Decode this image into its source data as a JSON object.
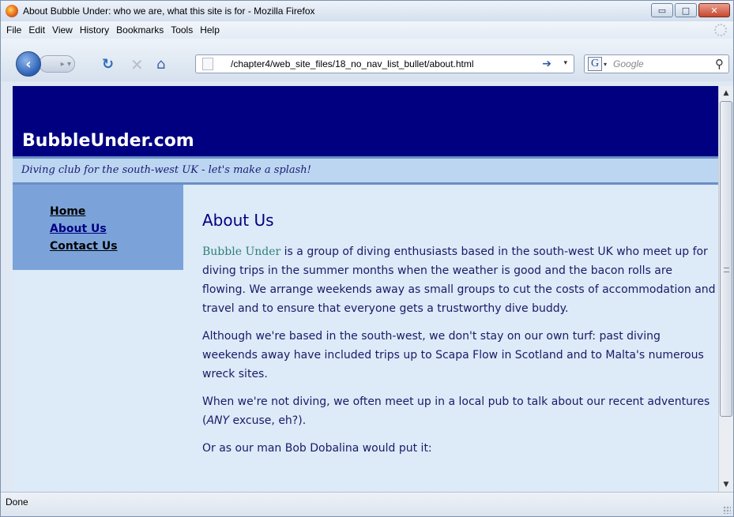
{
  "window": {
    "title": "About Bubble Under: who we are, what this site is for - Mozilla Firefox",
    "minimize_glyph": "▭",
    "maximize_glyph": "□",
    "close_glyph": "✕"
  },
  "menu": {
    "items": [
      "File",
      "Edit",
      "View",
      "History",
      "Bookmarks",
      "Tools",
      "Help"
    ]
  },
  "toolbar": {
    "url": "/chapter4/web_site_files/18_no_nav_list_bullet/about.html",
    "search_placeholder": "Google",
    "search_engine_glyph": "G",
    "back_glyph": "‹",
    "forward_glyph": "▸ ▾",
    "reload_glyph": "↻",
    "stop_glyph": "✕",
    "home_glyph": "⌂",
    "go_glyph": "➔",
    "dropdown_glyph": "▾",
    "search_glyph": "⚲"
  },
  "site": {
    "title": "BubbleUnder.com",
    "tagline": "Diving club for the south-west UK - let's make a splash!",
    "nav": [
      "Home",
      "About Us",
      "Contact Us"
    ],
    "heading": "About Us",
    "p1_brand": "Bubble Under",
    "p1_rest": " is a group of diving enthusiasts based in the south-west UK who meet up for diving trips in the summer months when the weather is good and the bacon rolls are flowing. We arrange weekends away as small groups to cut the costs of accommodation and travel and to ensure that everyone gets a trustworthy dive buddy.",
    "p2": "Although we're based in the south-west, we don't stay on our own turf: past diving weekends away have included trips up to Scapa Flow in Scotland and to Malta's numerous wreck sites.",
    "p3_start": "When we're not diving, we often meet up in a local pub to talk about our recent adventures (",
    "p3_em": "ANY",
    "p3_end": " excuse, eh?).",
    "p4": "Or as our man Bob Dobalina would put it:"
  },
  "scrollbar": {
    "up_glyph": "▲",
    "down_glyph": "▼"
  },
  "status": {
    "text": "Done"
  },
  "colors": {
    "header_bg": "#000080",
    "tagline_bg": "#bcd6f2",
    "nav_bg": "#7ba3da",
    "content_bg": "#ddeaf8",
    "brand_accent": "#2f7f7a"
  }
}
